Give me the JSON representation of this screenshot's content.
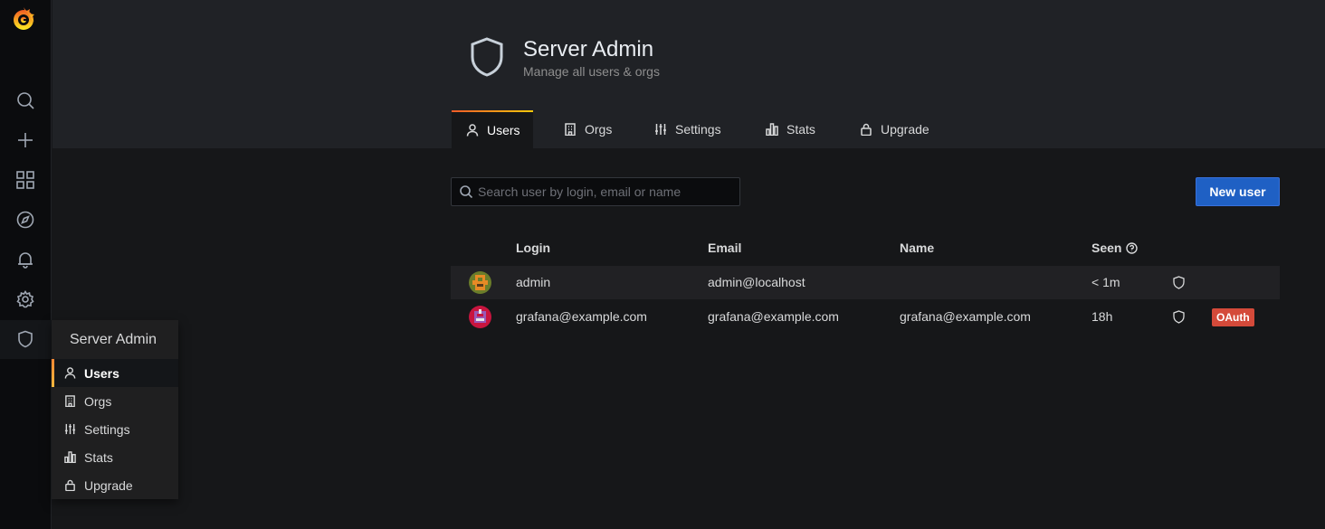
{
  "sidenav": {
    "items": [
      "search-icon",
      "plus-icon",
      "dashboards-icon",
      "explore-icon",
      "alerting-icon",
      "config-icon",
      "shield-icon"
    ],
    "dropdown": {
      "title": "Server Admin",
      "items": [
        {
          "label": "Users",
          "icon": "user-icon",
          "active": true
        },
        {
          "label": "Orgs",
          "icon": "building-icon"
        },
        {
          "label": "Settings",
          "icon": "sliders-icon"
        },
        {
          "label": "Stats",
          "icon": "bar-chart-icon"
        },
        {
          "label": "Upgrade",
          "icon": "lock-icon"
        }
      ]
    }
  },
  "header": {
    "title": "Server Admin",
    "subtitle": "Manage all users & orgs",
    "tabs": [
      {
        "label": "Users",
        "active": true
      },
      {
        "label": "Orgs"
      },
      {
        "label": "Settings"
      },
      {
        "label": "Stats"
      },
      {
        "label": "Upgrade"
      }
    ]
  },
  "search": {
    "placeholder": "Search user by login, email or name"
  },
  "actions": {
    "new_user": "New user"
  },
  "table": {
    "columns": {
      "login": "Login",
      "email": "Email",
      "name": "Name",
      "seen": "Seen"
    },
    "rows": [
      {
        "login": "admin",
        "email": "admin@localhost",
        "name": "",
        "seen": "< 1m",
        "badge": ""
      },
      {
        "login": "grafana@example.com",
        "email": "grafana@example.com",
        "name": "grafana@example.com",
        "seen": "18h",
        "badge": "OAuth"
      }
    ]
  },
  "colors": {
    "accent": "#f05a28",
    "primary": "#1f60c4",
    "badge": "#d44a3a"
  }
}
